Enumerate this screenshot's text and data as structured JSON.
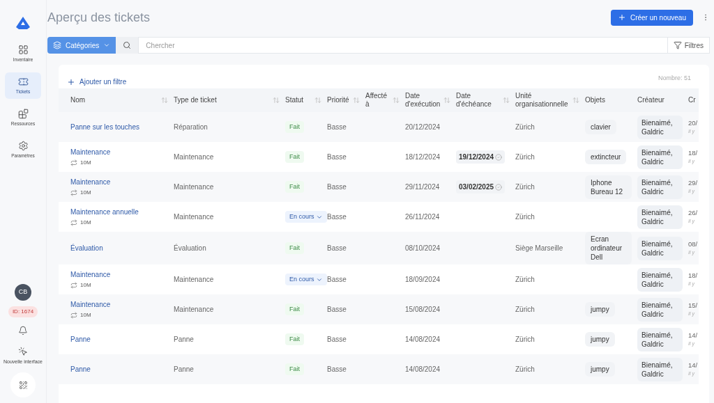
{
  "sidebar": {
    "items": [
      {
        "label": "Inventaire",
        "selected": false
      },
      {
        "label": "Tickets",
        "selected": true
      },
      {
        "label": "Ressources",
        "selected": false
      },
      {
        "label": "Paramètres",
        "selected": false
      }
    ],
    "avatar": "CB",
    "id_badge": "ID: 1674",
    "new_interface": "Nouvelle interface"
  },
  "title": "Aperçu des tickets",
  "create_button": "Créer un nouveau",
  "toolbar": {
    "categories": "Catégories",
    "search_placeholder": "Chercher",
    "filters": "Filtres"
  },
  "add_filter": "Ajouter un filtre",
  "count": "Nombre: 51",
  "table": {
    "columns": [
      {
        "label": "Nom",
        "sortable": true
      },
      {
        "label": "Type de ticket",
        "sortable": true
      },
      {
        "label": "Statut",
        "sortable": true
      },
      {
        "label": "Priorité",
        "sortable": true
      },
      {
        "label": "Affecté à",
        "sortable": true
      },
      {
        "label": "Date d'exécution",
        "sortable": true
      },
      {
        "label": "Date d'échéance",
        "sortable": true
      },
      {
        "label": "Unité organisationnelle",
        "sortable": true
      },
      {
        "label": "Objets",
        "sortable": false
      },
      {
        "label": "Créateur",
        "sortable": false
      },
      {
        "label": "Cr"
      }
    ],
    "rows": [
      {
        "name": "Panne sur les touches",
        "type": "Réparation",
        "status": {
          "label": "Fait",
          "kind": "done"
        },
        "priority": "Basse",
        "exec_date": "20/12/2024",
        "unit": "Zürich",
        "objects": "clavier",
        "creator": "Bienaimé, Galdric",
        "created": "20/",
        "ago": "Il y"
      },
      {
        "name": "Maintenance",
        "recurrence": "10M",
        "type": "Maintenance",
        "status": {
          "label": "Fait",
          "kind": "done"
        },
        "priority": "Basse",
        "exec_date": "18/12/2024",
        "due_date": "19/12/2024",
        "unit": "Zürich",
        "objects": "extincteur",
        "creator": "Bienaimé, Galdric",
        "created": "18/",
        "ago": "Il y"
      },
      {
        "name": "Maintenance",
        "recurrence": "10M",
        "type": "Maintenance",
        "status": {
          "label": "Fait",
          "kind": "done"
        },
        "priority": "Basse",
        "exec_date": "29/11/2024",
        "due_date": "03/02/2025",
        "unit": "Zürich",
        "objects": "Iphone Bureau 12",
        "creator": "Bienaimé, Galdric",
        "created": "29/",
        "ago": "Il y"
      },
      {
        "name": "Maintenance annuelle",
        "recurrence": "10M",
        "type": "Maintenance",
        "status": {
          "label": "En cours",
          "kind": "in_progress"
        },
        "priority": "Basse",
        "exec_date": "26/11/2024",
        "unit": "Zürich",
        "creator": "Bienaimé, Galdric",
        "created": "26/",
        "ago": "Il y"
      },
      {
        "name": "Évaluation",
        "type": "Évaluation",
        "status": {
          "label": "Fait",
          "kind": "done"
        },
        "priority": "Basse",
        "exec_date": "08/10/2024",
        "unit": "Siège Marseille",
        "objects": "Ecran ordinateur Dell",
        "creator": "Bienaimé, Galdric",
        "created": "08/",
        "ago": "Il y"
      },
      {
        "name": "Maintenance",
        "recurrence": "10M",
        "type": "Maintenance",
        "status": {
          "label": "En cours",
          "kind": "in_progress"
        },
        "priority": "Basse",
        "exec_date": "18/09/2024",
        "unit": "Zürich",
        "creator": "Bienaimé, Galdric",
        "created": "18/",
        "ago": "Il y"
      },
      {
        "name": "Maintenance",
        "recurrence": "10M",
        "type": "Maintenance",
        "status": {
          "label": "Fait",
          "kind": "done"
        },
        "priority": "Basse",
        "exec_date": "15/08/2024",
        "unit": "Zürich",
        "objects": "jumpy",
        "creator": "Bienaimé, Galdric",
        "created": "15/",
        "ago": "Il y"
      },
      {
        "name": "Panne",
        "type": "Panne",
        "status": {
          "label": "Fait",
          "kind": "done"
        },
        "priority": "Basse",
        "exec_date": "14/08/2024",
        "unit": "Zürich",
        "objects": "jumpy",
        "creator": "Bienaimé, Galdric",
        "created": "14/",
        "ago": "Il y"
      },
      {
        "name": "Panne",
        "type": "Panne",
        "status": {
          "label": "Fait",
          "kind": "done"
        },
        "priority": "Basse",
        "exec_date": "14/08/2024",
        "unit": "Zürich",
        "objects": "jumpy",
        "creator": "Bienaimé, Galdric",
        "created": "14/",
        "ago": "Il y"
      }
    ]
  }
}
